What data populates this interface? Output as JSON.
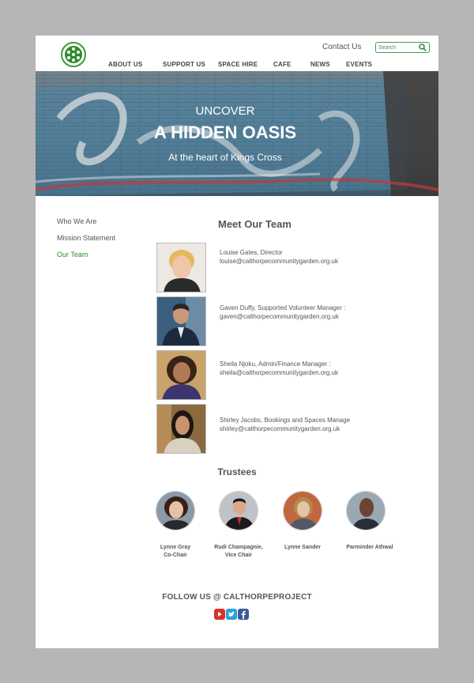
{
  "header": {
    "contact_label": "Contact Us",
    "search_placeholder": "Search"
  },
  "nav": {
    "items": [
      "ABOUT US",
      "SUPPORT US",
      "SPACE HIRE",
      "CAFE",
      "NEWS",
      "EVENTS"
    ]
  },
  "hero": {
    "line1": "UNCOVER",
    "line2": "A HIDDEN OASIS",
    "line3": "At the heart of Kings Cross"
  },
  "sidebar": {
    "items": [
      "Who We Are",
      "Mission Statement",
      "Our Team"
    ],
    "active_index": 2
  },
  "team": {
    "heading": "Meet Our Team",
    "members": [
      {
        "line1": "Louise Gates, Director",
        "line2": "louise@calthorpecommunitygarden.org.uk"
      },
      {
        "line1": "Gaven Duffy, Supported Volunteer Manager :",
        "line2": "gaven@calthorpecommunitygarden.org.uk"
      },
      {
        "line1": "Sheila Njoku, Admin/Finance Manager :",
        "line2": "sheila@calthorpecommunitygarden.org.uk"
      },
      {
        "line1": "Shirley Jacobs, Bookings and Spaces Manage",
        "line2": "shirley@calthorpecommunitygarden.org.uk"
      }
    ]
  },
  "trustees": {
    "heading": "Trustees",
    "people": [
      {
        "line1": "Lynne Gray",
        "line2": "Co-Chair"
      },
      {
        "line1": "Rudi Champagnie,",
        "line2": "Vice Chair"
      },
      {
        "line1": "Lynne Sander",
        "line2": ""
      },
      {
        "line1": "Parminder Athwal",
        "line2": ""
      }
    ]
  },
  "footer": {
    "follow_text": "FOLLOW US @ CALTHORPEPROJECT",
    "social_icons": [
      "youtube-icon",
      "twitter-icon",
      "facebook-icon"
    ]
  },
  "colors": {
    "accent_green": "#2e8b2e",
    "youtube": "#d9302a",
    "twitter": "#2aa0dd",
    "facebook": "#3b5998"
  }
}
